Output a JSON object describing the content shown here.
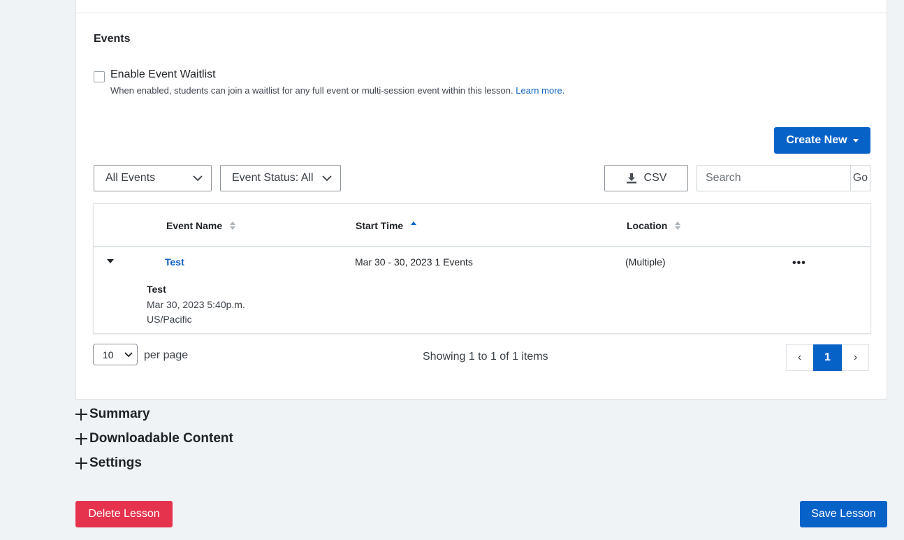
{
  "events_section": {
    "title": "Events",
    "waitlist": {
      "label": "Enable Event Waitlist",
      "checked": false,
      "help_text": "When enabled, students can join a waitlist for any full event or multi-session event within this lesson.",
      "learn_more": "Learn more."
    },
    "create_new_label": "Create New",
    "filters": {
      "events_select": "All Events",
      "status_select": "Event Status: All"
    },
    "csv_label": "CSV",
    "search": {
      "placeholder": "Search",
      "go_label": "Go"
    },
    "table": {
      "columns": [
        "Event Name",
        "Start Time",
        "Location"
      ],
      "rows": [
        {
          "name": "Test",
          "start": "Mar 30 - 30, 2023 1 Events",
          "location": "(Multiple)",
          "actions": "•••",
          "sub": {
            "title": "Test",
            "date": "Mar 30, 2023 5:40p.m.",
            "timezone": "US/Pacific"
          }
        }
      ]
    },
    "pagination": {
      "per_page_value": "10",
      "per_page_label": "per page",
      "showing": "Showing 1 to 1 of 1 items",
      "prev": "‹",
      "current": "1",
      "next": "›"
    }
  },
  "accordions": [
    "Summary",
    "Downloadable Content",
    "Settings"
  ],
  "footer": {
    "delete_label": "Delete Lesson",
    "save_label": "Save Lesson"
  },
  "colors": {
    "primary": "#0762c8",
    "danger": "#e5334d",
    "link": "#0a5fc4"
  },
  "icons": {
    "sort": "sort-icon",
    "sort_up": "sort-asc-icon",
    "download": "download-icon",
    "plus": "plus-icon"
  }
}
